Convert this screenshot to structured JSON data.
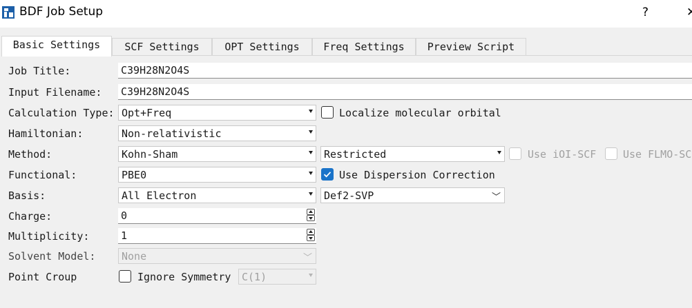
{
  "window": {
    "title": "BDF Job Setup",
    "help": "?",
    "close": "✕",
    "accent_color": "#1a73c9"
  },
  "tabs": [
    {
      "label": "Basic Settings",
      "active": true
    },
    {
      "label": "SCF Settings",
      "active": false
    },
    {
      "label": "OPT Settings",
      "active": false
    },
    {
      "label": "Freq Settings",
      "active": false
    },
    {
      "label": "Preview Script",
      "active": false
    }
  ],
  "form": {
    "job_title": {
      "label": "Job Title:",
      "value": "C39H28N2O4S"
    },
    "input_filename": {
      "label": "Input Filename:",
      "value": "C39H28N2O4S"
    },
    "calculation_type": {
      "label": "Calculation Type:",
      "value": "Opt+Freq"
    },
    "localize_orbital": {
      "label": "Localize molecular orbital",
      "checked": false
    },
    "hamiltonian": {
      "label": "Hamiltonian:",
      "value": "Non-relativistic"
    },
    "method": {
      "label": "Method:",
      "value": "Kohn-Sham"
    },
    "restriction": {
      "value": "Restricted"
    },
    "use_ioi_scf": {
      "label": "Use iOI-SCF",
      "checked": false,
      "enabled": false
    },
    "use_flmo_scf": {
      "label": "Use FLMO-SC",
      "checked": false,
      "enabled": false
    },
    "functional": {
      "label": "Functional:",
      "value": "PBE0"
    },
    "dispersion": {
      "label": "Use Dispersion Correction",
      "checked": true
    },
    "basis": {
      "label": "Basis:",
      "value": "All Electron"
    },
    "basis_set": {
      "value": "Def2-SVP"
    },
    "charge": {
      "label": "Charge:",
      "value": "0"
    },
    "multiplicity": {
      "label": "Multiplicity:",
      "value": "1"
    },
    "solvent_model": {
      "label": "Solvent Model:",
      "value": "None",
      "enabled": false
    },
    "point_group": {
      "label": "Point Croup",
      "value": "C(1)",
      "enabled": false
    },
    "ignore_symmetry": {
      "label": "Ignore Symmetry",
      "checked": false
    }
  }
}
